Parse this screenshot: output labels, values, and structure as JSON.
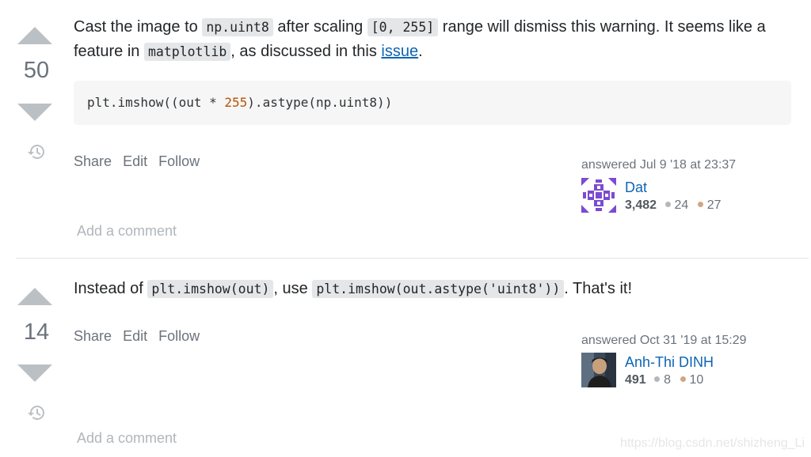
{
  "answers": [
    {
      "votes": "50",
      "body": {
        "p1": "Cast the image to ",
        "code1": "np.uint8",
        "p2": " after scaling ",
        "code2": "[0, 255]",
        "p3": " range will dismiss this warning. It seems like a feature in ",
        "code3": "matplotlib",
        "p4": ", as discussed in this ",
        "link": "issue",
        "p5": "."
      },
      "codeblock": {
        "pre": "plt.imshow((out * ",
        "num": "255",
        "post": ").astype(np.uint8))"
      },
      "menu": [
        "Share",
        "Edit",
        "Follow"
      ],
      "signature": {
        "time": "answered Jul 9 '18 at 23:37",
        "user": "Dat",
        "reputation": "3,482",
        "silver": "24",
        "bronze": "27"
      },
      "add_comment": "Add a comment"
    },
    {
      "votes": "14",
      "body": {
        "p1": "Instead of ",
        "code1": "plt.imshow(out)",
        "p2": ", use ",
        "code2": "plt.imshow(out.astype('uint8'))",
        "p3": ". That's it!"
      },
      "menu": [
        "Share",
        "Edit",
        "Follow"
      ],
      "signature": {
        "time": "answered Oct 31 '19 at 15:29",
        "user": "Anh-Thi DINH",
        "reputation": "491",
        "silver": "8",
        "bronze": "10"
      },
      "add_comment": "Add a comment"
    }
  ],
  "watermark": "https://blog.csdn.net/shizheng_Li",
  "colors": {
    "link": "#0c65b4",
    "vote_arrow": "#bbc0c4",
    "silver_badge": "#b4b8bc",
    "bronze_badge": "#d1a684",
    "code_bg": "#e4e6e8"
  }
}
